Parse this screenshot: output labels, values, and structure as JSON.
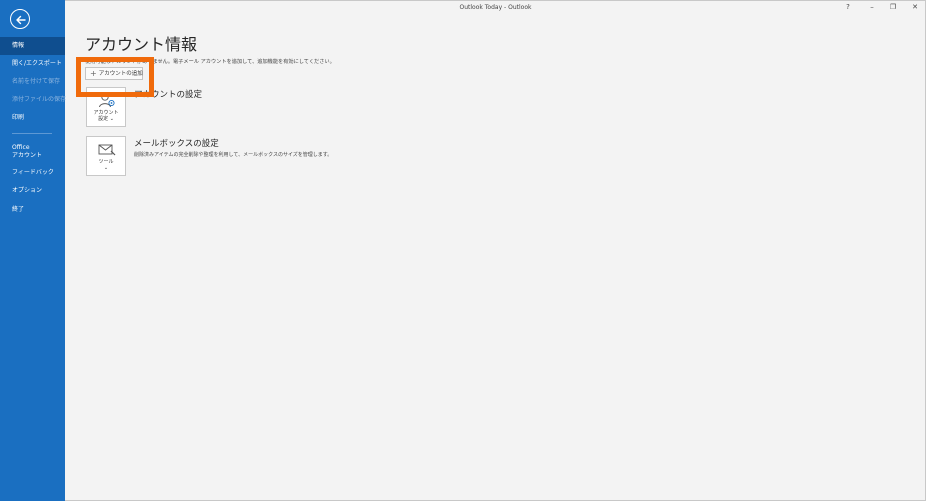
{
  "window": {
    "title": "Outlook Today  -  Outlook",
    "help": "?",
    "minimize": "–",
    "restore": "❐",
    "close": "✕"
  },
  "sidebar": {
    "items": [
      {
        "label": "情報",
        "state": "active"
      },
      {
        "label": "開く/エクスポート",
        "state": "normal"
      },
      {
        "label": "名前を付けて保存",
        "state": "disabled"
      },
      {
        "label": "添付ファイルの保存",
        "state": "disabled"
      },
      {
        "label": "印刷",
        "state": "normal"
      },
      {
        "label_line1": "Office",
        "label_line2": "アカウント",
        "state": "normal"
      },
      {
        "label": "フィードバック",
        "state": "normal"
      },
      {
        "label": "オプション",
        "state": "normal"
      },
      {
        "label": "終了",
        "state": "normal"
      }
    ]
  },
  "main": {
    "title": "アカウント情報",
    "intro": "使用可能なアカウントがありません。電子メール アカウントを追加して、追加機能を有効にしてください。",
    "add_account_button": "アカウントの追加",
    "account_settings": {
      "tile_line1": "アカウント",
      "tile_line2": "設定 ⌄",
      "title": "アカウントの設定"
    },
    "mailbox_settings": {
      "tile_line1": "ツール",
      "tile_line2": "⌄",
      "title": "メールボックスの設定",
      "description": "削除済みアイテムの完全削除や整理を利用して、メールボックスのサイズを管理します。"
    }
  },
  "colors": {
    "sidebar": "#1a6fc1",
    "sidebar_active": "#0f4e8f",
    "highlight": "#f06a0b"
  }
}
